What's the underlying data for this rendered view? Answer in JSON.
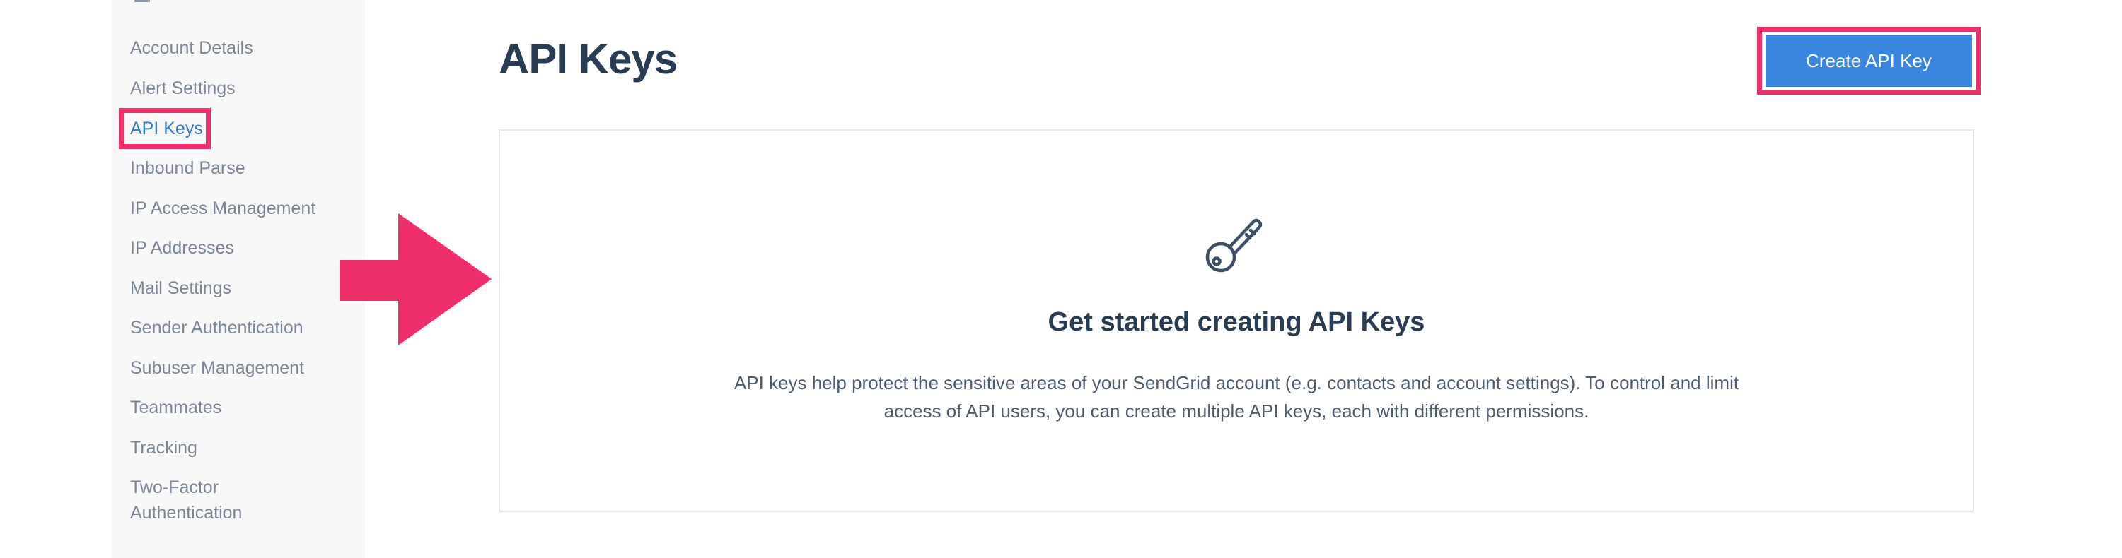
{
  "sidebar": {
    "items": [
      {
        "label": "Account Details"
      },
      {
        "label": "Alert Settings"
      },
      {
        "label": "API Keys",
        "active": true
      },
      {
        "label": "Inbound Parse"
      },
      {
        "label": "IP Access Management"
      },
      {
        "label": "IP Addresses"
      },
      {
        "label": "Mail Settings"
      },
      {
        "label": "Sender Authentication"
      },
      {
        "label": "Subuser Management"
      },
      {
        "label": "Teammates"
      },
      {
        "label": "Tracking"
      },
      {
        "label": "Two-Factor Authentication"
      }
    ]
  },
  "header": {
    "title": "API Keys",
    "create_button_label": "Create API Key"
  },
  "empty_state": {
    "icon": "key-icon",
    "heading": "Get started creating API Keys",
    "description": "API keys help protect the sensitive areas of your SendGrid account (e.g. contacts and account settings). To control and limit access of API users, you can create multiple API keys, each with different permissions."
  },
  "colors": {
    "annotation": "#ee2f6a",
    "primary_button": "#3a85dd",
    "active_link": "#2f7ad6",
    "heading": "#2a3b54",
    "sidebar_text": "#7c8796"
  }
}
